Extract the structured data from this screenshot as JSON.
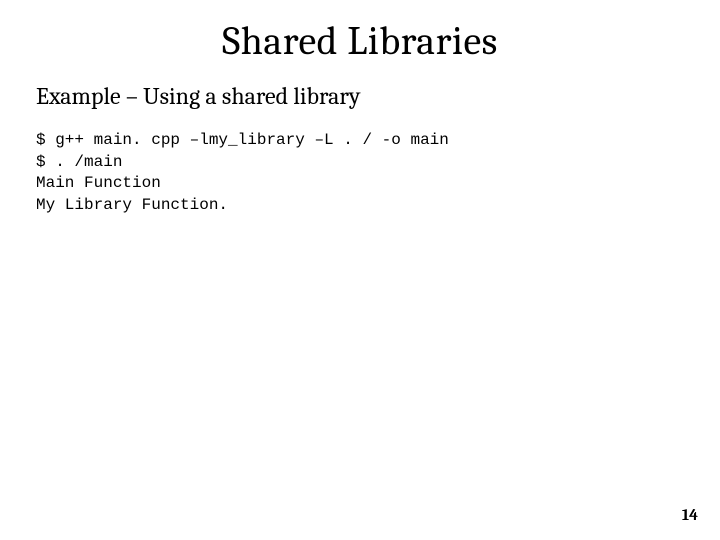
{
  "title": "Shared Libraries",
  "subtitle": "Example – Using a shared library",
  "code": {
    "l1": "$ g++ main. cpp –lmy_library –L . / -o main",
    "l2": "$ . /main",
    "l3": "Main Function",
    "l4": "My Library Function."
  },
  "page_number": "14"
}
